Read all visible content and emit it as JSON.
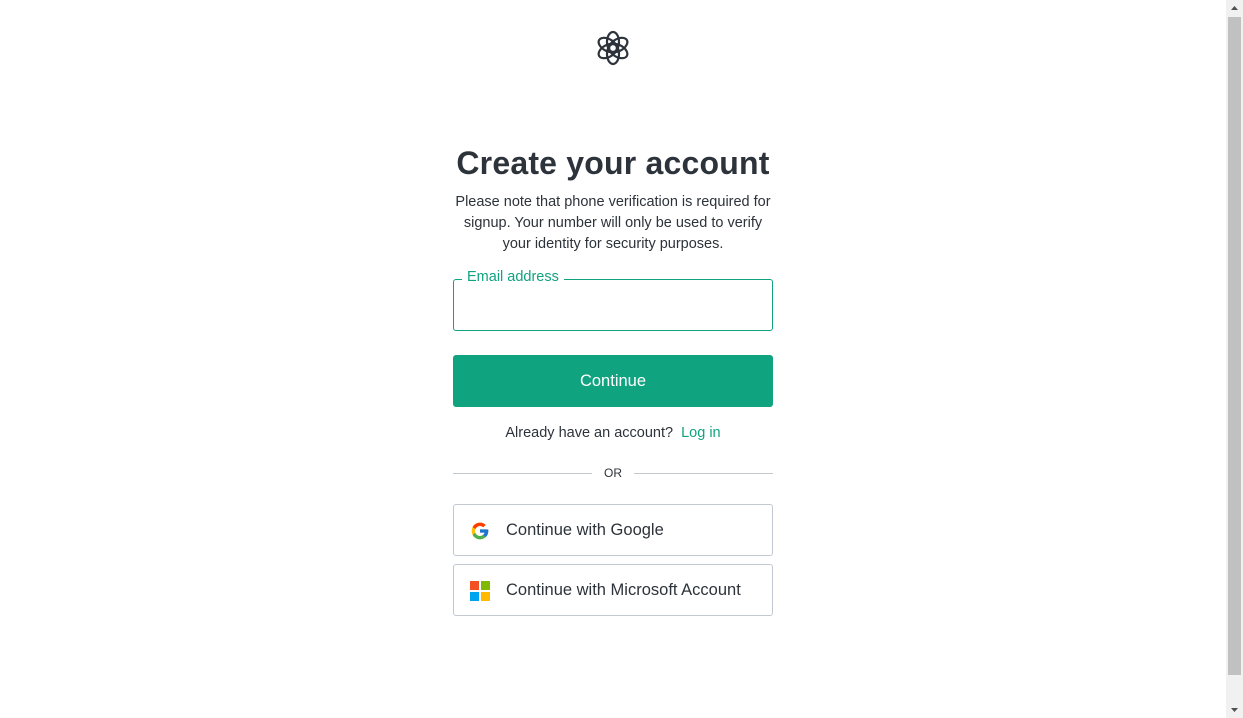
{
  "brand": {
    "logo_icon": "openai-logo-icon"
  },
  "heading": {
    "title": "Create your account",
    "subtitle": "Please note that phone verification is required for signup. Your number will only be used to verify your identity for security purposes."
  },
  "form": {
    "email_label": "Email address",
    "email_value": "",
    "continue_label": "Continue",
    "accent_color": "#10a37f"
  },
  "login": {
    "prompt": "Already have an account?",
    "link_label": "Log in"
  },
  "divider": {
    "text": "OR"
  },
  "social": {
    "google_label": "Continue with Google",
    "microsoft_label": "Continue with Microsoft Account"
  }
}
